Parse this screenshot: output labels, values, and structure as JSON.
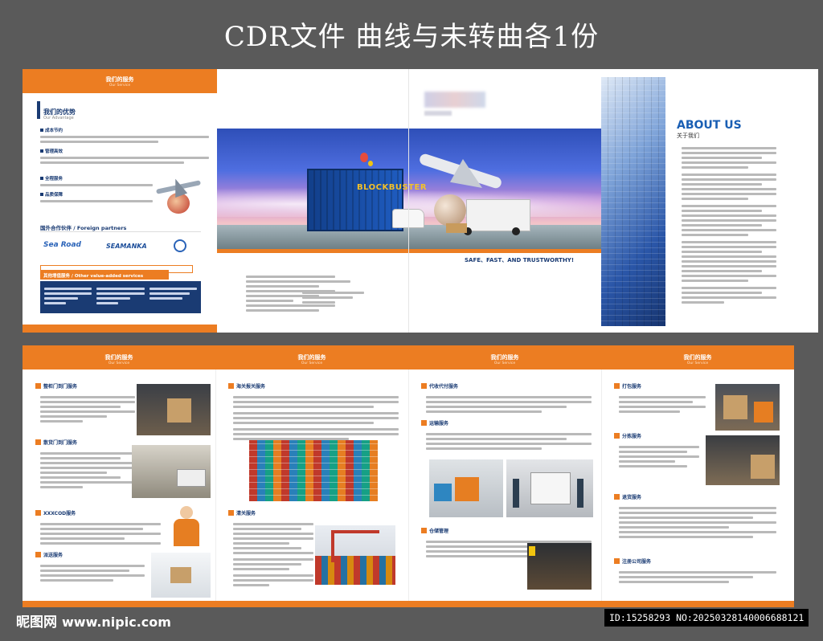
{
  "header": {
    "title": "CDR文件 曲线与未转曲各1份"
  },
  "top_left": {
    "bar_title": "我们的服务",
    "bar_sub": "Our Service",
    "adv_title": "我们的优势",
    "adv_sub": "Our Advantage",
    "items": [
      "成本节约",
      "管理高效",
      "全程服务",
      "品质保障"
    ],
    "partners_title": "国外合作伙伴 / Foreign partners",
    "partners": [
      "Sea Road",
      "SEAMANKA"
    ],
    "vas_title": "其他增值服务 / Other value-added services"
  },
  "cover": {
    "container_text": "BLOCKBUSTER",
    "slogan": "SAFE、FAST、AND TRUSTWORTHY!"
  },
  "about": {
    "title": "ABOUT US",
    "sub": "关于我们"
  },
  "bottom": {
    "bar_title": "我们的服务",
    "bar_sub": "Our Service",
    "p1": [
      "整柜门到门服务",
      "散货门到门服务",
      "XXXCOD服务",
      "派送服务"
    ],
    "p2": [
      "海关报关服务",
      "清关服务"
    ],
    "p3": [
      "代收代付服务",
      "运输服务",
      "仓储管理"
    ],
    "p4": [
      "打包服务",
      "分拣服务",
      "退货服务",
      "注册公司服务"
    ]
  },
  "watermark": {
    "site": "昵图网",
    "url": "www.nipic.com",
    "id": "ID:15258293 NO:20250328140006688121"
  },
  "colors": {
    "accent": "#ec7d22",
    "navy": "#1a3b73",
    "bg": "#5a5a5a"
  }
}
